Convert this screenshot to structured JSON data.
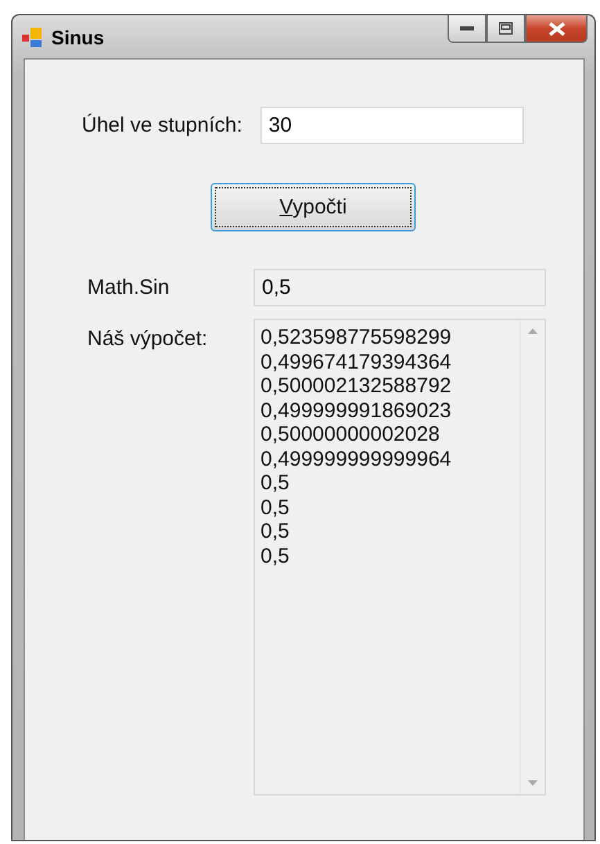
{
  "window": {
    "title": "Sinus"
  },
  "angle": {
    "label": "Úhel ve stupních:",
    "value": "30"
  },
  "button": {
    "label": "Vypočti",
    "focused": true
  },
  "math_sin": {
    "label": "Math.Sin",
    "value": "0,5"
  },
  "our_calc": {
    "label": "Náš výpočet:",
    "lines": [
      "0,523598775598299",
      "0,499674179394364",
      "0,500002132588792",
      "0,499999991869023",
      "0,50000000002028",
      "0,499999999999964",
      "0,5",
      "0,5",
      "0,5",
      "0,5"
    ]
  }
}
